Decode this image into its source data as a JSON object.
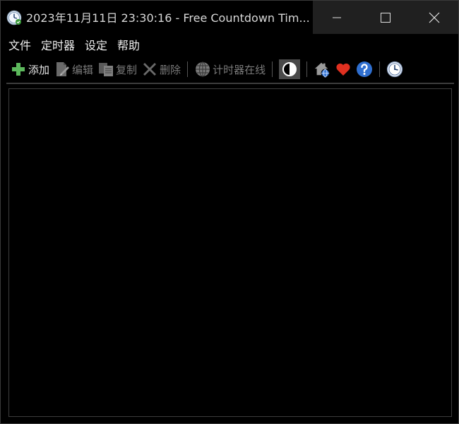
{
  "window": {
    "title": "2023年11月11日 23:30:16 - Free Countdown Tim...",
    "icon": "clock-app-icon"
  },
  "caption": {
    "minimize": "minimize-icon",
    "maximize": "maximize-icon",
    "close": "close-icon"
  },
  "menu": {
    "items": [
      "文件",
      "定时器",
      "设定",
      "帮助"
    ]
  },
  "toolbar": {
    "add_label": "添加",
    "edit_label": "编辑",
    "copy_label": "复制",
    "delete_label": "删除",
    "online_label": "计时器在线"
  },
  "colors": {
    "add_green": "#5cb85c",
    "heart_red": "#e03020",
    "help_blue": "#2f6fd0",
    "background": "#000000"
  }
}
